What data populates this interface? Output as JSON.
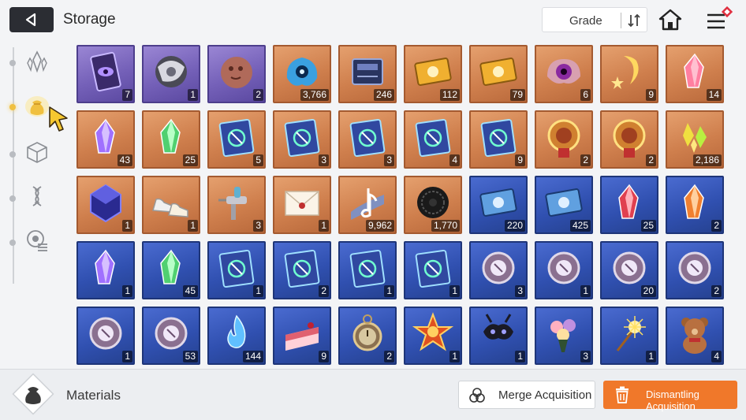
{
  "header": {
    "title": "Storage",
    "grade_label": "Grade"
  },
  "sidebar": {
    "items": [
      {
        "name": "crystals",
        "icon": "crystal-icon"
      },
      {
        "name": "materials",
        "icon": "pouch-icon",
        "active": true
      },
      {
        "name": "cubes",
        "icon": "cube-icon"
      },
      {
        "name": "genes",
        "icon": "dna-icon"
      },
      {
        "name": "modules",
        "icon": "chip-list-icon"
      }
    ]
  },
  "items": [
    {
      "icon": "card-eye-icon",
      "rarity": "purple",
      "qty": "7"
    },
    {
      "icon": "silver-orb-icon",
      "rarity": "purple",
      "qty": "1"
    },
    {
      "icon": "stone-face-icon",
      "rarity": "purple",
      "qty": "2"
    },
    {
      "icon": "blue-creature-icon",
      "rarity": "orange",
      "qty": "3,766"
    },
    {
      "icon": "chip-icon",
      "rarity": "orange",
      "qty": "246"
    },
    {
      "icon": "gold-ticket-icon",
      "rarity": "orange",
      "qty": "112"
    },
    {
      "icon": "gold-ticket-icon",
      "rarity": "orange",
      "qty": "79"
    },
    {
      "icon": "purple-eye-icon",
      "rarity": "orange",
      "qty": "6"
    },
    {
      "icon": "moon-star-icon",
      "rarity": "orange",
      "qty": "9"
    },
    {
      "icon": "pink-crystal-icon",
      "rarity": "orange",
      "qty": "14"
    },
    {
      "icon": "purple-crystal-icon",
      "rarity": "orange",
      "qty": "43"
    },
    {
      "icon": "green-crystal-icon",
      "rarity": "orange",
      "qty": "25"
    },
    {
      "icon": "book-icon",
      "rarity": "orange",
      "qty": "5"
    },
    {
      "icon": "book-icon",
      "rarity": "orange",
      "qty": "3"
    },
    {
      "icon": "book-icon",
      "rarity": "orange",
      "qty": "3"
    },
    {
      "icon": "book-icon",
      "rarity": "orange",
      "qty": "4"
    },
    {
      "icon": "book-icon",
      "rarity": "orange",
      "qty": "9"
    },
    {
      "icon": "medal-icon",
      "rarity": "orange",
      "qty": "2"
    },
    {
      "icon": "medal-icon",
      "rarity": "orange",
      "qty": "2"
    },
    {
      "icon": "yellow-shard-icon",
      "rarity": "orange",
      "qty": "2,186"
    },
    {
      "icon": "blue-cube-icon",
      "rarity": "orange",
      "qty": "1"
    },
    {
      "icon": "sneakers-icon",
      "rarity": "orange",
      "qty": "1"
    },
    {
      "icon": "spray-gun-icon",
      "rarity": "orange",
      "qty": "3"
    },
    {
      "icon": "envelope-icon",
      "rarity": "orange",
      "qty": "1"
    },
    {
      "icon": "music-note-icon",
      "rarity": "orange",
      "qty": "9,962"
    },
    {
      "icon": "black-flower-icon",
      "rarity": "orange",
      "qty": "1,770"
    },
    {
      "icon": "blue-ticket-icon",
      "rarity": "blue",
      "qty": "220"
    },
    {
      "icon": "blue-ticket-icon",
      "rarity": "blue",
      "qty": "425"
    },
    {
      "icon": "red-crystal-icon",
      "rarity": "blue",
      "qty": "25"
    },
    {
      "icon": "orange-crystal-icon",
      "rarity": "blue",
      "qty": "2"
    },
    {
      "icon": "purple-crystal-icon",
      "rarity": "blue",
      "qty": "1"
    },
    {
      "icon": "green-crystal-icon",
      "rarity": "blue",
      "qty": "45"
    },
    {
      "icon": "book-icon",
      "rarity": "blue",
      "qty": "1"
    },
    {
      "icon": "book-icon",
      "rarity": "blue",
      "qty": "2"
    },
    {
      "icon": "book-icon",
      "rarity": "blue",
      "qty": "1"
    },
    {
      "icon": "book-icon",
      "rarity": "blue",
      "qty": "1"
    },
    {
      "icon": "silver-medal-icon",
      "rarity": "blue",
      "qty": "3"
    },
    {
      "icon": "silver-medal-icon",
      "rarity": "blue",
      "qty": "1"
    },
    {
      "icon": "silver-medal-icon",
      "rarity": "blue",
      "qty": "20"
    },
    {
      "icon": "silver-medal-icon",
      "rarity": "blue",
      "qty": "2"
    },
    {
      "icon": "silver-medal-icon",
      "rarity": "blue",
      "qty": "1"
    },
    {
      "icon": "silver-medal-icon",
      "rarity": "blue",
      "qty": "53"
    },
    {
      "icon": "blue-flame-icon",
      "rarity": "blue",
      "qty": "144"
    },
    {
      "icon": "cake-icon",
      "rarity": "blue",
      "qty": "9"
    },
    {
      "icon": "pocket-watch-icon",
      "rarity": "blue",
      "qty": "2"
    },
    {
      "icon": "star-medal-icon",
      "rarity": "blue",
      "qty": "1"
    },
    {
      "icon": "black-mask-icon",
      "rarity": "blue",
      "qty": "1"
    },
    {
      "icon": "bouquet-icon",
      "rarity": "blue",
      "qty": "3"
    },
    {
      "icon": "sparkler-icon",
      "rarity": "blue",
      "qty": "1"
    },
    {
      "icon": "teddy-bear-icon",
      "rarity": "blue",
      "qty": "4"
    }
  ],
  "footer": {
    "category_label": "Materials",
    "merge_label": "Merge Acquisition",
    "dismantle_label": "Dismantling Acquisition"
  },
  "colors": {
    "accent": "#f0782a",
    "purple_frame": "#7460b8",
    "orange_frame": "#cf7f4d",
    "blue_frame": "#3050b0"
  }
}
